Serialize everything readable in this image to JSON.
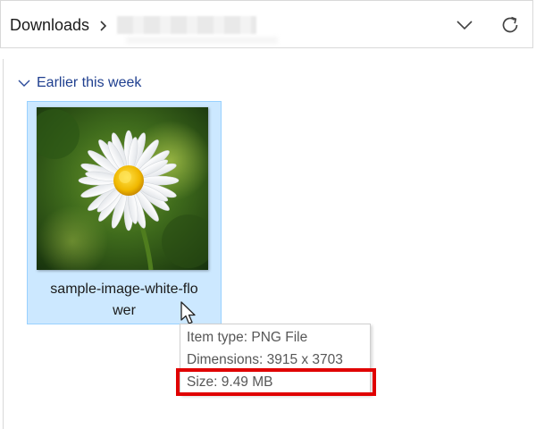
{
  "address_bar": {
    "crumb": "Downloads",
    "separator_icon": "chevron-right-icon",
    "history_icon": "chevron-down-icon",
    "refresh_icon": "refresh-icon"
  },
  "group": {
    "label": "Earlier this week",
    "icon": "chevron-down-icon"
  },
  "file": {
    "name": "sample-image-white-flower",
    "selected": true,
    "thumbnail": "white daisy flower"
  },
  "tooltip": {
    "item_type": "Item type: PNG File",
    "dimensions": "Dimensions: 3915 x 3703",
    "size": "Size: 9.49 MB"
  },
  "colors": {
    "selection_fill": "#cce8ff",
    "selection_border": "#99d1ff",
    "group_label": "#1f3f8f",
    "highlight": "#e00000"
  }
}
